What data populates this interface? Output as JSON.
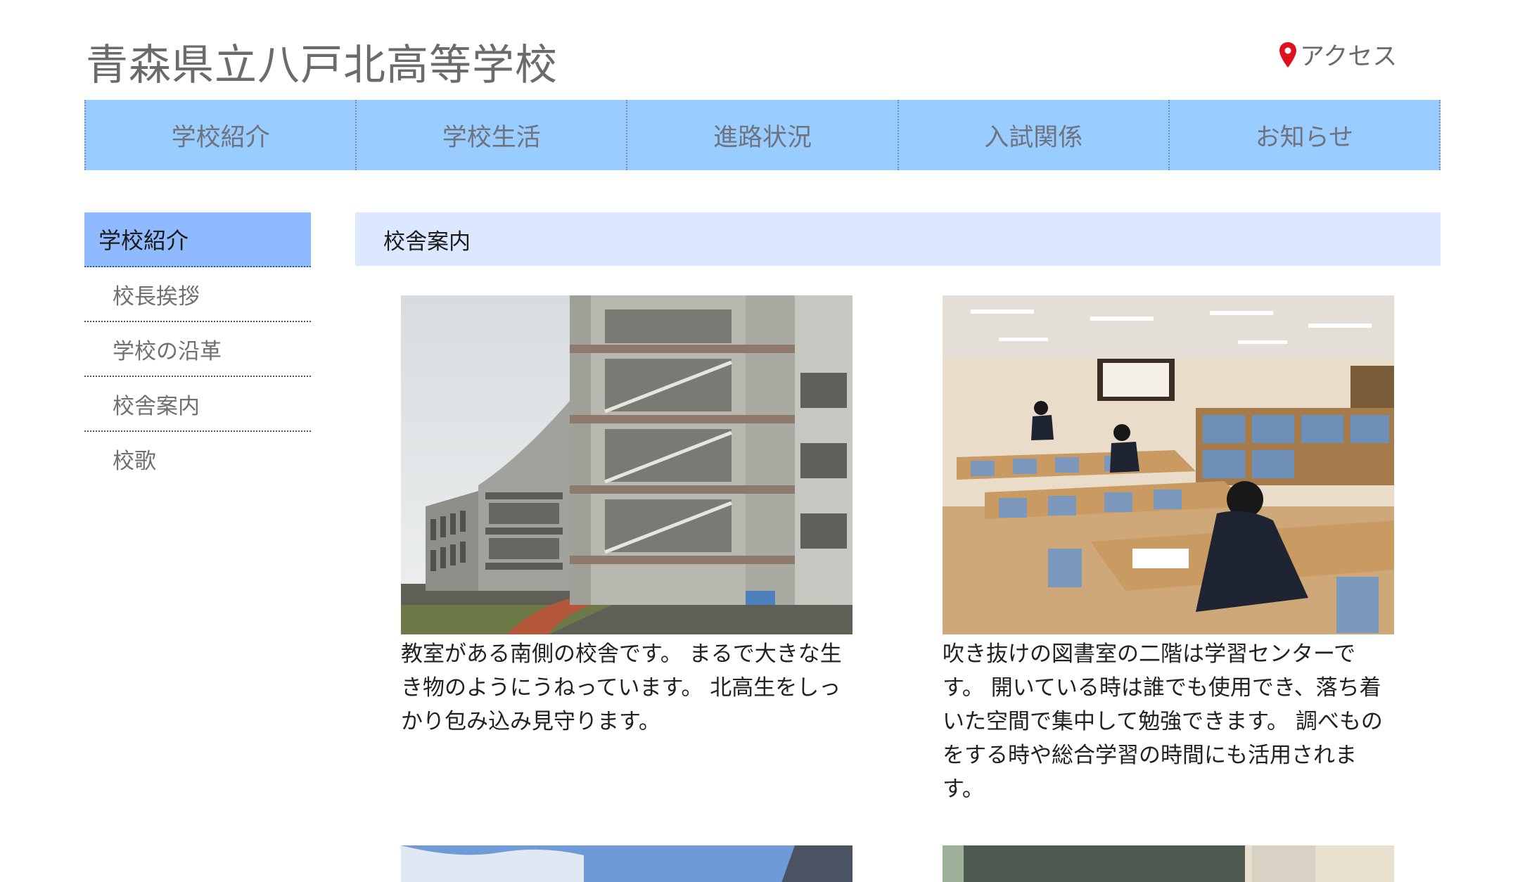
{
  "header": {
    "site_title": "青森県立八戸北高等学校",
    "access_label": "アクセス"
  },
  "global_nav": {
    "items": [
      {
        "label": "学校紹介"
      },
      {
        "label": "学校生活"
      },
      {
        "label": "進路状況"
      },
      {
        "label": "入試関係"
      },
      {
        "label": "お知らせ"
      }
    ]
  },
  "side_menu": {
    "heading": "学校紹介",
    "items": [
      {
        "label": "校長挨拶"
      },
      {
        "label": "学校の沿革"
      },
      {
        "label": "校舎案内"
      },
      {
        "label": "校歌"
      }
    ]
  },
  "main": {
    "section_title": "校舎案内",
    "cards": [
      {
        "image": "school-building-photo",
        "caption": "教室がある南側の校舎です。 まるで大きな生き物のようにうねっています。 北高生をしっかり包み込み見守ります。"
      },
      {
        "image": "library-study-center-photo",
        "caption": "吹き抜けの図書室の二階は学習センターです。 開いている時は誰でも使用でき、落ち着いた空間で集中して勉強できます。 調べものをする時や総合学習の時間にも活用されます。"
      }
    ]
  },
  "colors": {
    "nav_bg": "#99ccff",
    "side_head_bg": "#8fbaff",
    "section_head_bg": "#dce8ff",
    "pin_red": "#e0101e"
  }
}
